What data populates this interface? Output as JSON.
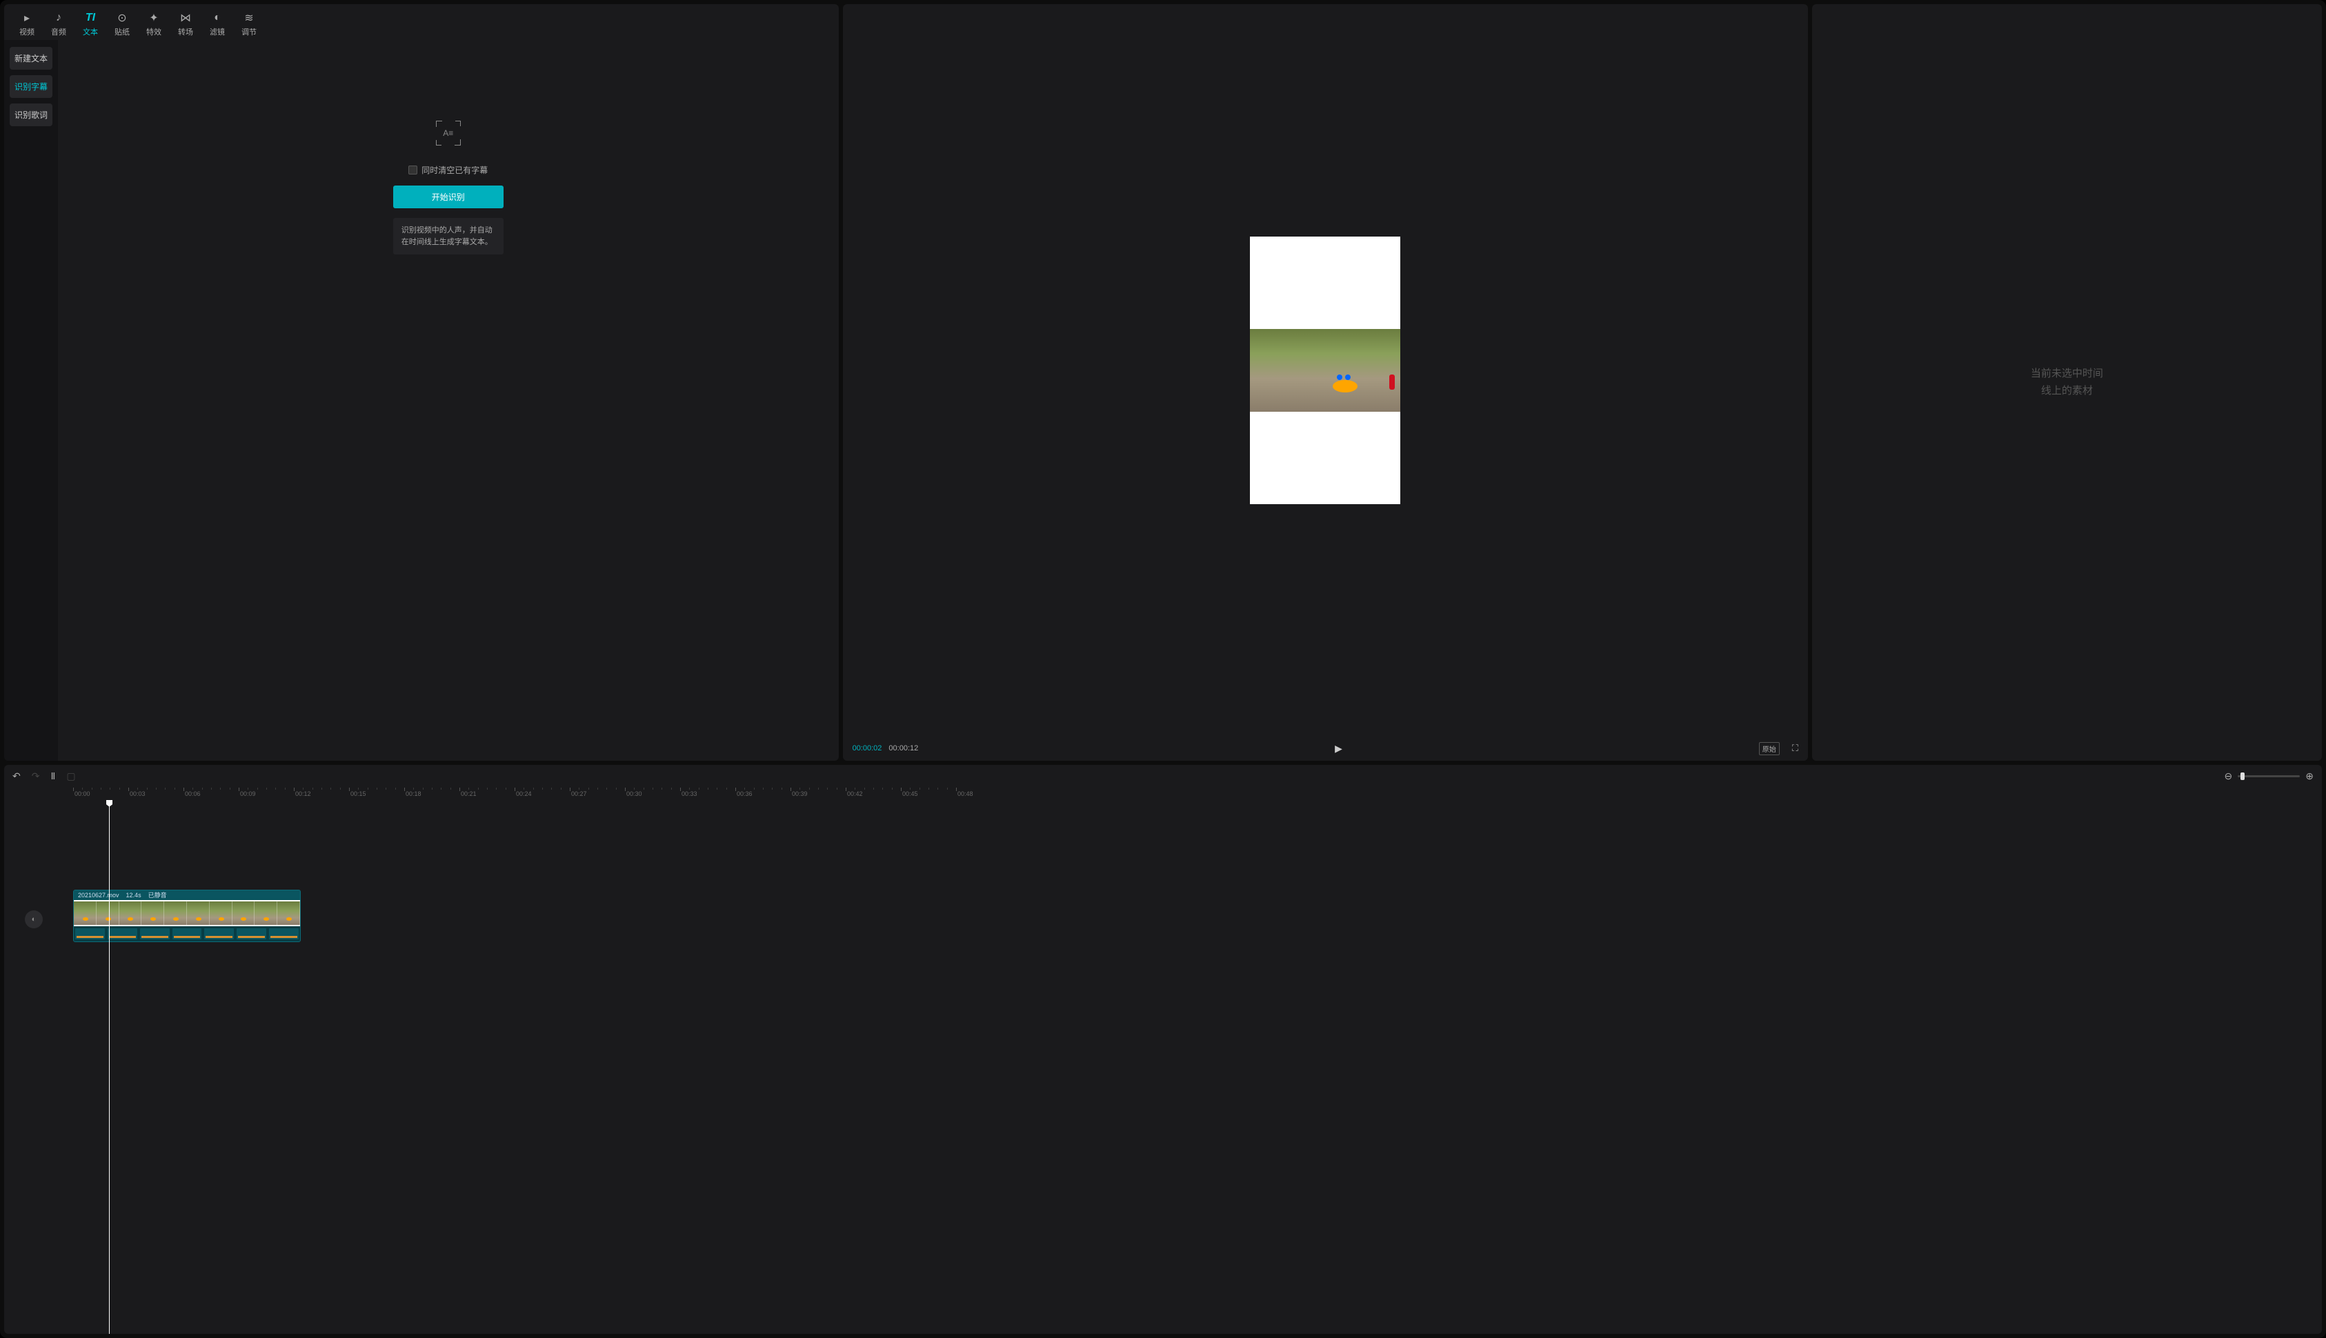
{
  "topTabs": [
    {
      "label": "视频",
      "icon": "▸"
    },
    {
      "label": "音频",
      "icon": "♪"
    },
    {
      "label": "文本",
      "icon": "T"
    },
    {
      "label": "贴纸",
      "icon": "⊙"
    },
    {
      "label": "特效",
      "icon": "✦"
    },
    {
      "label": "转场",
      "icon": "⋈"
    },
    {
      "label": "滤镜",
      "icon": "◐"
    },
    {
      "label": "调节",
      "icon": "≋"
    }
  ],
  "activeTopTab": 2,
  "sideItems": [
    "新建文本",
    "识别字幕",
    "识别歌词"
  ],
  "activeSideItem": 1,
  "subtitlePanel": {
    "iconText": "A≡",
    "checkboxLabel": "同时清空已有字幕",
    "buttonLabel": "开始识别",
    "hintText": "识别视频中的人声，并自动在时间线上生成字幕文本。"
  },
  "preview": {
    "currentTime": "00:00:02",
    "totalTime": "00:00:12",
    "ratioLabel": "原始"
  },
  "rightPanel": {
    "emptyLine1": "当前未选中时间",
    "emptyLine2": "线上的素材"
  },
  "ruler": {
    "marks": [
      "00:00",
      "00:03",
      "00:06",
      "00:09",
      "00:12",
      "00:15",
      "00:18",
      "00:21",
      "00:24",
      "00:27",
      "00:30",
      "00:33",
      "00:36",
      "00:39",
      "00:42",
      "00:45",
      "00:48"
    ]
  },
  "clip": {
    "filename": "20210627.mov",
    "duration": "12.4s",
    "muteLabel": "已静音"
  }
}
